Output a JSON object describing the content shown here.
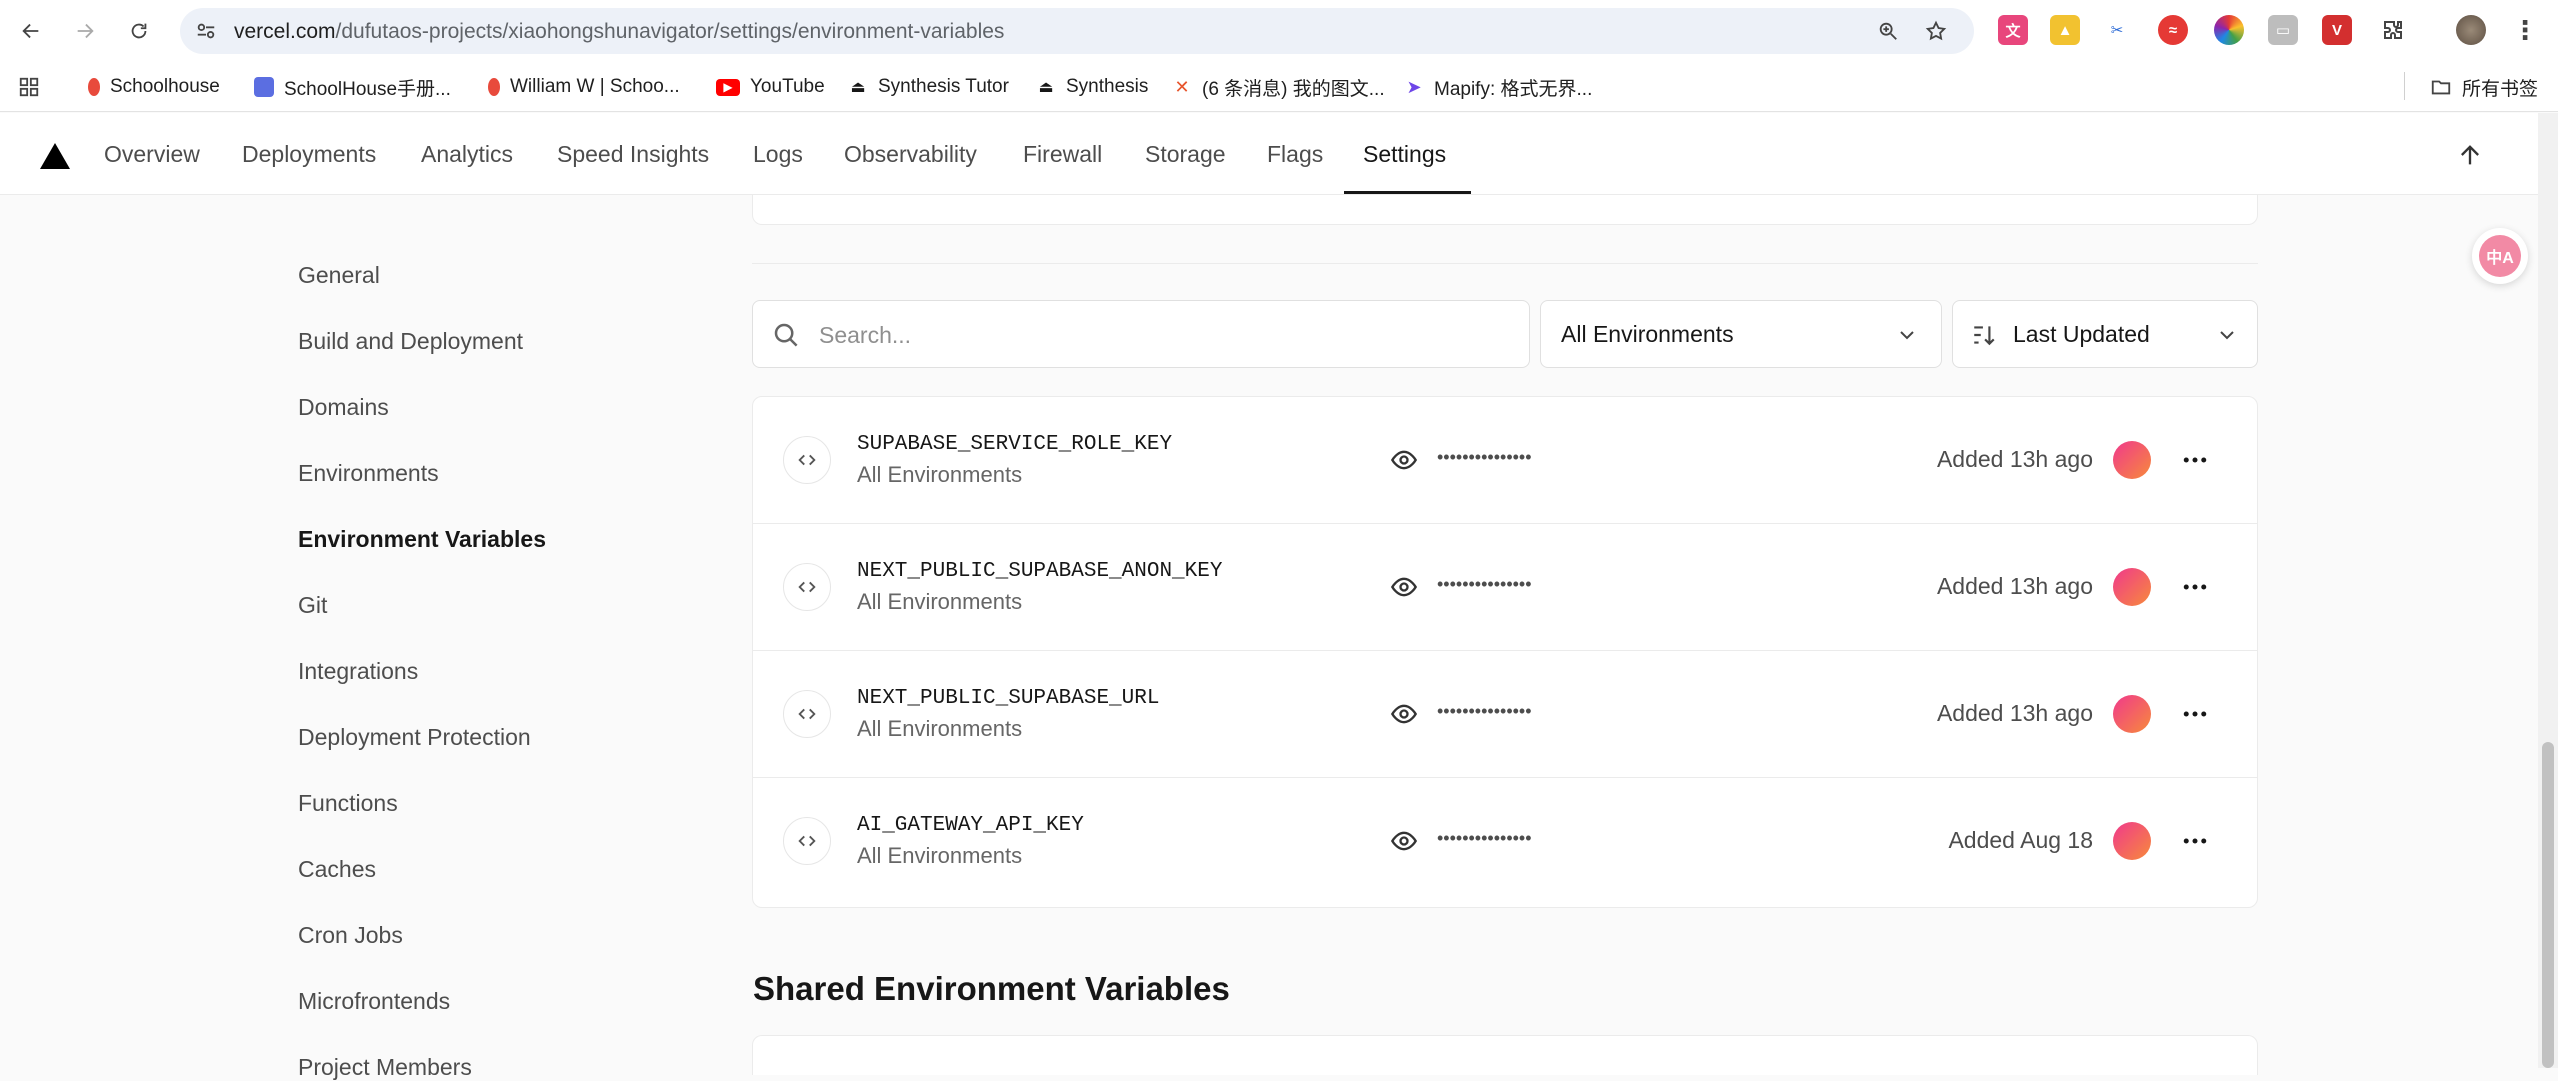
{
  "browser": {
    "url_host": "vercel.com",
    "url_path": "/dufutaos-projects/xiaohongshunavigator/settings/environment-variables",
    "bookmarks": [
      {
        "label": "Schoolhouse",
        "icon": "schoolhouse-icon",
        "color": "#e84a3c"
      },
      {
        "label": "SchoolHouse手册...",
        "icon": "schoolhouse-manual-icon",
        "color": "#5b6ee1"
      },
      {
        "label": "William W | Schoo...",
        "icon": "schoolhouse-icon",
        "color": "#e84a3c"
      },
      {
        "label": "YouTube",
        "icon": "youtube-icon",
        "color": "#ff0000"
      },
      {
        "label": "Synthesis Tutor",
        "icon": "synthesis-icon",
        "color": "#171717"
      },
      {
        "label": "Synthesis",
        "icon": "synthesis-icon",
        "color": "#171717"
      },
      {
        "label": "(6 条消息) 我的图文...",
        "icon": "xiaohongshu-icon",
        "color": "#e7552c"
      },
      {
        "label": "Mapify: 格式无界...",
        "icon": "mapify-icon",
        "color": "#6e46e8"
      }
    ],
    "all_bookmarks": "所有书签"
  },
  "nav": {
    "tabs": [
      "Overview",
      "Deployments",
      "Analytics",
      "Speed Insights",
      "Logs",
      "Observability",
      "Firewall",
      "Storage",
      "Flags",
      "Settings"
    ],
    "active_tab": "Settings"
  },
  "sidebar": {
    "items": [
      "General",
      "Build and Deployment",
      "Domains",
      "Environments",
      "Environment Variables",
      "Git",
      "Integrations",
      "Deployment Protection",
      "Functions",
      "Caches",
      "Cron Jobs",
      "Microfrontends",
      "Project Members"
    ],
    "active": "Environment Variables"
  },
  "filters": {
    "search_placeholder": "Search...",
    "environment": "All Environments",
    "sort": "Last Updated"
  },
  "variables": [
    {
      "name": "SUPABASE_SERVICE_ROLE_KEY",
      "environments": "All Environments",
      "masked": "•••••••••••••••",
      "added": "Added 13h ago"
    },
    {
      "name": "NEXT_PUBLIC_SUPABASE_ANON_KEY",
      "environments": "All Environments",
      "masked": "•••••••••••••••",
      "added": "Added 13h ago"
    },
    {
      "name": "NEXT_PUBLIC_SUPABASE_URL",
      "environments": "All Environments",
      "masked": "•••••••••••••••",
      "added": "Added 13h ago"
    },
    {
      "name": "AI_GATEWAY_API_KEY",
      "environments": "All Environments",
      "masked": "•••••••••••••••",
      "added": "Added Aug 18"
    }
  ],
  "shared_section_title": "Shared Environment Variables",
  "translate_fab": "中A"
}
